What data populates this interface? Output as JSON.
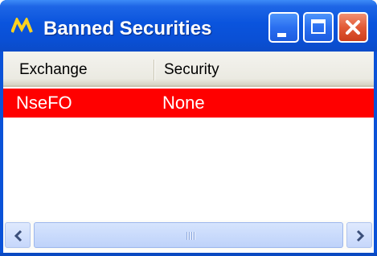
{
  "window": {
    "title": "Banned Securities",
    "icon": "app-logo-icon",
    "controls": {
      "minimize_icon": "minimize-icon",
      "maximize_icon": "maximize-icon",
      "close_icon": "close-icon"
    }
  },
  "table": {
    "columns": [
      "Exchange",
      "Security"
    ],
    "rows": [
      {
        "exchange": "NseFO",
        "security": "None",
        "highlight_color": "#ff0000"
      }
    ]
  },
  "scrollbar": {
    "left_icon": "scroll-left-icon",
    "right_icon": "scroll-right-icon"
  },
  "colors": {
    "titlebar": "#0a54dd",
    "row_highlight": "#ff0000",
    "close_button": "#e25a36"
  }
}
